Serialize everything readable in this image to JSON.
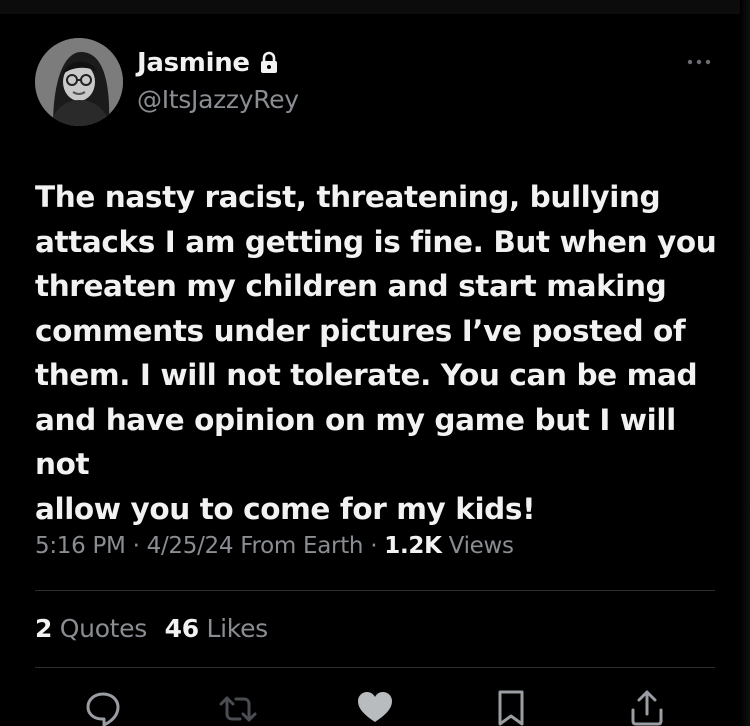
{
  "author": {
    "name": "Jasmine",
    "handle": "@ItsJazzyRey",
    "protected_icon": "lock-icon",
    "avatar_icon": "profile-photo"
  },
  "menu": {
    "more_icon": "more-dots-icon"
  },
  "tweet": {
    "text": "The nasty racist, threatening, bullying\nattacks I am getting is fine. But when you\nthreaten my children and start making\ncomments under pictures I’ve posted of\nthem. I will not tolerate. You can be mad\nand have opinion on my game but I will not\nallow you to come for my kids!"
  },
  "meta": {
    "time": "5:16 PM",
    "separator": " · ",
    "date": "4/25/24",
    "source": "From Earth",
    "views_count": "1.2K",
    "views_label": "Views"
  },
  "stats": {
    "quotes_count": "2",
    "quotes_label": "Quotes",
    "likes_count": "46",
    "likes_label": "Likes"
  },
  "actions": [
    {
      "icon": "reply-icon"
    },
    {
      "icon": "retweet-icon"
    },
    {
      "icon": "like-heart-icon"
    },
    {
      "icon": "bookmark-icon"
    },
    {
      "icon": "share-icon"
    }
  ],
  "colors": {
    "background": "#000000",
    "primary_text": "#f2f2f2",
    "secondary_text": "#8a8d91",
    "divider": "#2a2d30"
  }
}
